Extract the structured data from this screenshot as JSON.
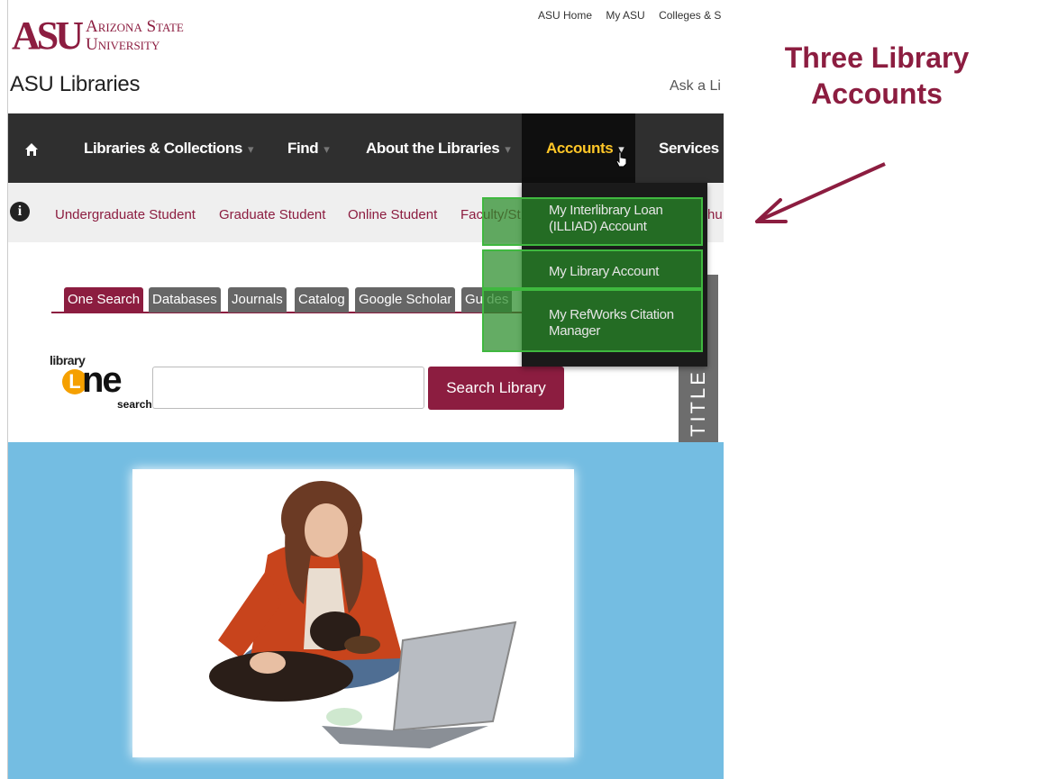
{
  "header": {
    "logo_text": "ASU",
    "university_name_line1": "Arizona State",
    "university_name_line2": "University",
    "site_title": "ASU Libraries",
    "util_links": [
      "ASU Home",
      "My ASU",
      "Colleges & S"
    ],
    "ask_link": "Ask a Li"
  },
  "nav": {
    "home_icon": "home-icon",
    "items": [
      {
        "label": "Libraries & Collections"
      },
      {
        "label": "Find"
      },
      {
        "label": "About the Libraries"
      },
      {
        "label": "Accounts"
      },
      {
        "label": "Services"
      }
    ]
  },
  "accounts_menu": {
    "items": [
      {
        "label": "My Interlibrary Loan (ILLIAD) Account"
      },
      {
        "label": "My Library Account"
      },
      {
        "label": "My RefWorks Citation Manager"
      }
    ]
  },
  "audience": {
    "info_icon": "info-icon",
    "links": [
      "Undergraduate Student",
      "Graduate Student",
      "Online Student",
      "Faculty/St",
      "hu"
    ]
  },
  "search": {
    "tabs": [
      "One Search",
      "Databases",
      "Journals",
      "Catalog",
      "Google Scholar",
      "Gu des"
    ],
    "active_tab": "One Search",
    "logo_small": "library",
    "logo_big_l": "L",
    "logo_big_rest": "ne",
    "logo_sub": "search",
    "input_value": "",
    "button_label": "Search Library"
  },
  "side_strip": {
    "label": "TITLE"
  },
  "annotation": {
    "line1": "Three Library",
    "line2": "Accounts"
  },
  "colors": {
    "maroon": "#8c1d40",
    "gold": "#ffc627",
    "nav_bg": "#2f2f2f",
    "highlight_green": "#3fb83f",
    "hero_blue": "#74bde2"
  }
}
